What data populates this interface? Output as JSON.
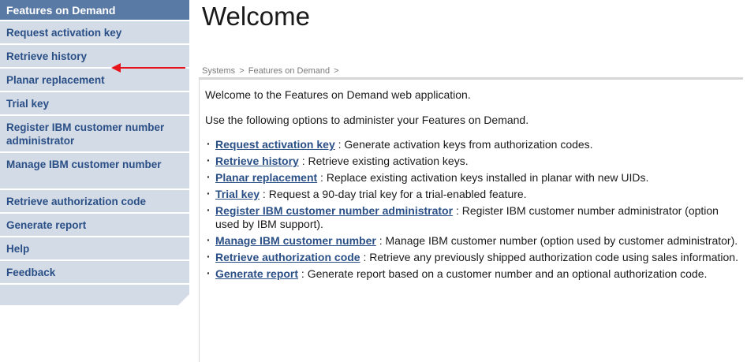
{
  "sidebar": {
    "header": "Features on Demand",
    "items": [
      {
        "label": "Request activation key"
      },
      {
        "label": "Retrieve history"
      },
      {
        "label": "Planar replacement"
      },
      {
        "label": "Trial key"
      },
      {
        "label": "Register IBM customer number administrator"
      },
      {
        "label": "Manage IBM customer number"
      },
      {
        "label": "Retrieve authorization code"
      },
      {
        "label": "Generate report"
      },
      {
        "label": "Help"
      },
      {
        "label": "Feedback"
      }
    ]
  },
  "annotation": {
    "arrow_color": "#e8141c"
  },
  "main": {
    "title": "Welcome",
    "breadcrumb": [
      "Systems",
      ">",
      "Features on Demand",
      ">"
    ],
    "intro": "Welcome to the Features on Demand web application.",
    "instructions": "Use the following options to administer your Features on Demand.",
    "options": [
      {
        "link": "Request activation key",
        "desc": " : Generate activation keys from authorization codes."
      },
      {
        "link": "Retrieve history",
        "desc": " : Retrieve existing activation keys."
      },
      {
        "link": "Planar replacement",
        "desc": " : Replace existing activation keys installed in planar with new UIDs."
      },
      {
        "link": "Trial key",
        "desc": " : Request a 90-day trial key for a trial-enabled feature."
      },
      {
        "link": "Register IBM customer number administrator",
        "desc": " : Register IBM customer number administrator (option used by IBM support)."
      },
      {
        "link": "Manage IBM customer number",
        "desc": " : Manage IBM customer number (option used by customer administrator)."
      },
      {
        "link": "Retrieve authorization code",
        "desc": " : Retrieve any previously shipped authorization code using sales information."
      },
      {
        "link": "Generate report",
        "desc": " : Generate report based on a customer number and an optional authorization code."
      }
    ]
  },
  "colors": {
    "nav_header_bg": "#5a7aa6",
    "nav_item_bg": "#d3dbe6",
    "link": "#2a4f86"
  }
}
